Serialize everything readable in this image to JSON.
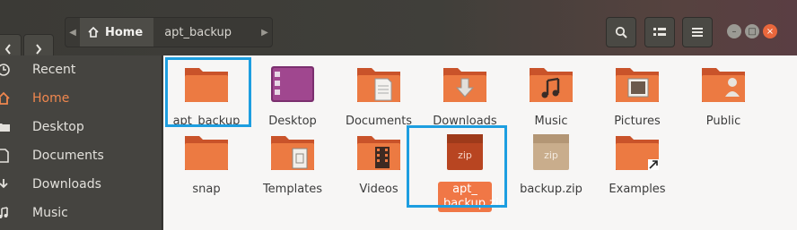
{
  "header": {
    "back_icon": "chevron-left-icon",
    "forward_icon": "chevron-right-icon",
    "breadcrumb": {
      "home_label": "Home",
      "current": "apt_backup"
    },
    "search_icon": "search-icon",
    "view_icon": "list-view-icon",
    "menu_icon": "hamburger-menu-icon"
  },
  "sidebar": {
    "items": [
      {
        "label": "Recent",
        "icon": "clock-icon"
      },
      {
        "label": "Home",
        "icon": "home-icon",
        "active": true
      },
      {
        "label": "Desktop",
        "icon": "folder-icon"
      },
      {
        "label": "Documents",
        "icon": "document-icon"
      },
      {
        "label": "Downloads",
        "icon": "download-icon"
      },
      {
        "label": "Music",
        "icon": "music-icon"
      }
    ]
  },
  "files": [
    {
      "label": "apt_backup"
    },
    {
      "label": "Desktop"
    },
    {
      "label": "Documents"
    },
    {
      "label": "Downloads"
    },
    {
      "label": "Music"
    },
    {
      "label": "Pictures"
    },
    {
      "label": "Public"
    },
    {
      "label": "snap"
    },
    {
      "label": "Templates"
    },
    {
      "label": "Videos"
    },
    {
      "label": "apt_ backup.zip",
      "selected": true
    },
    {
      "label": "backup.zip"
    },
    {
      "label": "Examples"
    }
  ],
  "zip_badge": "zip",
  "colors": {
    "accent": "#f07746",
    "highlight": "#1d9ee0",
    "folder": "#e8743c",
    "sidebar_bg": "#454440"
  }
}
